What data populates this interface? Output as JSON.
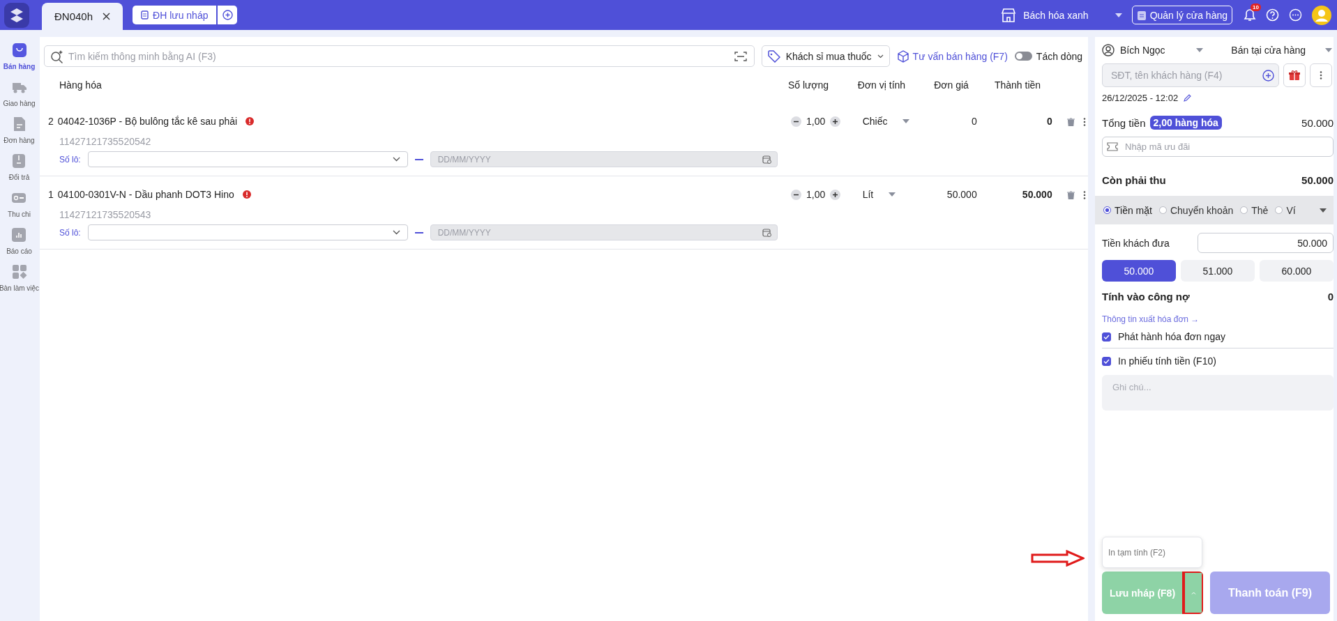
{
  "tabs": [
    {
      "label": "ĐN040h",
      "selected": true
    }
  ],
  "draft_orders_button": {
    "label": "ĐH lưu nháp"
  },
  "store": {
    "name": "Bách hóa xanh"
  },
  "manage_button": {
    "label": "Quản lý cửa hàng"
  },
  "notifications": {
    "count": "10"
  },
  "sidebar": {
    "items": [
      {
        "label": "Bán hàng",
        "kind": "bag",
        "selected": true
      },
      {
        "label": "Giao hàng",
        "kind": "truck",
        "selected": false
      },
      {
        "label": "Đơn hàng",
        "kind": "document",
        "selected": false
      },
      {
        "label": "Đổi trả",
        "kind": "box",
        "selected": false
      },
      {
        "label": "Thu chi",
        "kind": "wallet",
        "selected": false
      },
      {
        "label": "Báo cáo",
        "kind": "chart",
        "selected": false
      },
      {
        "label": "Bàn làm việc",
        "kind": "grid",
        "selected": false
      }
    ]
  },
  "search": {
    "placeholder": "Tìm kiếm thông minh bằng AI (F3)"
  },
  "price_list": {
    "value": "Khách sỉ mua thuốc"
  },
  "advice_link": {
    "label": "Tư vấn bán hàng (F7)"
  },
  "split_lines": {
    "label": "Tách dòng",
    "on": false
  },
  "table": {
    "columns": [
      "Hàng hóa",
      "Số lượng",
      "Đơn vị tính",
      "Đơn giá",
      "Thành tiền"
    ],
    "rows": [
      {
        "index": "2",
        "name": "04042-1036P - Bộ bulông tắc kê sau phải",
        "code": "11427121735520542",
        "quantity": "1,00",
        "unit": "Chiếc",
        "unit_price": "0",
        "total": "0",
        "lot_label": "Số lô:",
        "date_placeholder": "DD/MM/YYYY"
      },
      {
        "index": "1",
        "name": "04100-0301V-N - Dầu phanh DOT3 Hino",
        "code": "11427121735520543",
        "quantity": "1,00",
        "unit": "Lít",
        "unit_price": "50.000",
        "total": "50.000",
        "lot_label": "Số lô:",
        "date_placeholder": "DD/MM/YYYY"
      }
    ]
  },
  "customer": {
    "staff": "Bích Ngọc",
    "channel": "Bán tại cửa hàng",
    "search_placeholder": "SĐT, tên khách hàng (F4)",
    "datetime": "26/12/2025 - 12:02"
  },
  "summary": {
    "total_label": "Tổng tiền",
    "items_badge": "2,00 hàng hóa",
    "total": "50.000",
    "promo_placeholder": "Nhập mã ưu đãi",
    "due_label": "Còn phải thu",
    "due": "50.000"
  },
  "payment_methods": [
    {
      "label": "Tiền mặt",
      "selected": true
    },
    {
      "label": "Chuyển khoản",
      "selected": false
    },
    {
      "label": "Thẻ",
      "selected": false
    },
    {
      "label": "Ví",
      "selected": false
    }
  ],
  "paid": {
    "label": "Tiền khách đưa",
    "value": "50.000"
  },
  "quick_amounts": [
    {
      "label": "50.000",
      "selected": true
    },
    {
      "label": "51.000",
      "selected": false
    },
    {
      "label": "60.000",
      "selected": false
    }
  ],
  "debt": {
    "label": "Tính vào công nợ",
    "value": "0"
  },
  "invoice_link": {
    "label": "Thông tin xuất hóa đơn →"
  },
  "options": [
    {
      "label": "Phát hành hóa đơn ngay",
      "checked": true
    },
    {
      "label": "In phiếu tính tiền (F10)",
      "checked": true
    }
  ],
  "note": {
    "placeholder": "Ghi chú..."
  },
  "print_menu": {
    "items": [
      "In tạm tính (F2)"
    ],
    "pointed_by_arrow": true
  },
  "actions": [
    {
      "label": "Lưu nháp (F8)",
      "kind": "draft",
      "menu_highlighted": true
    },
    {
      "label": "Thanh toán (F9)",
      "kind": "pay"
    }
  ]
}
